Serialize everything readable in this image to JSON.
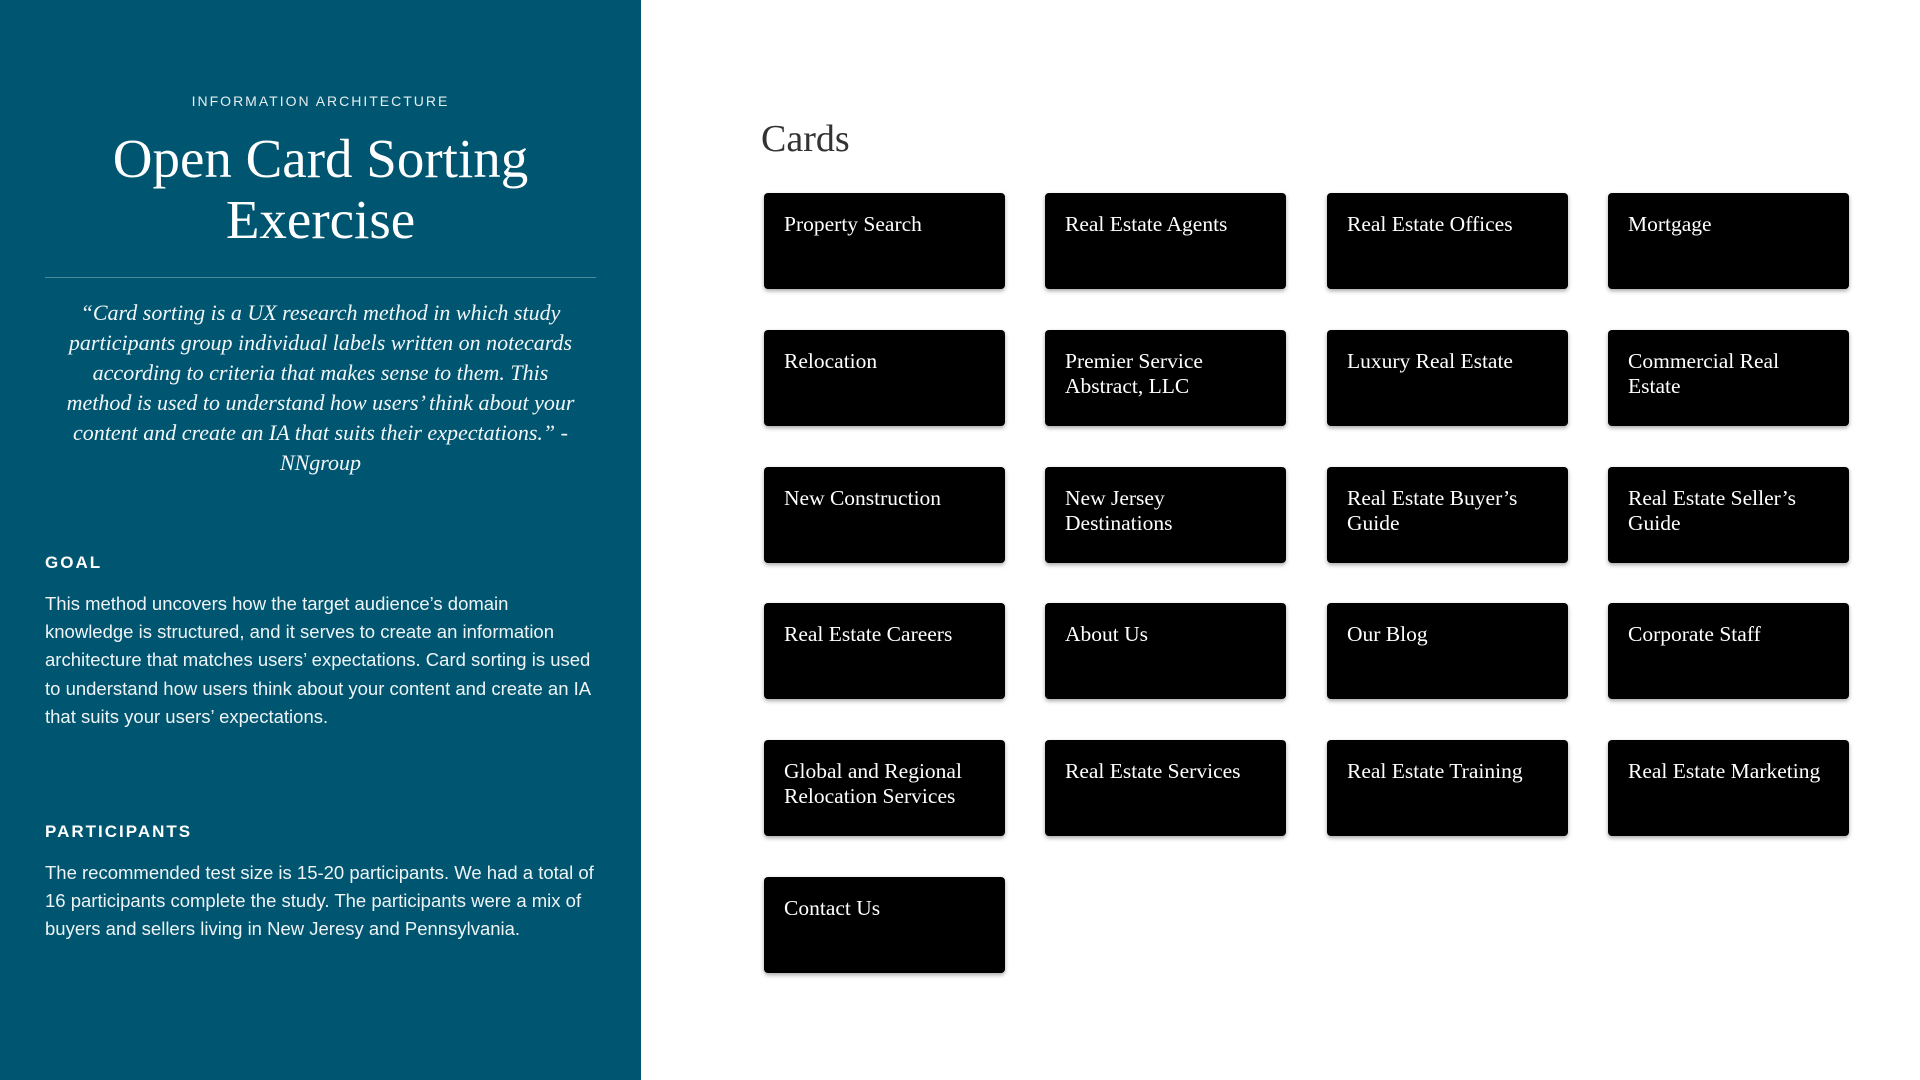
{
  "sidebar": {
    "eyebrow": "INFORMATION ARCHITECTURE",
    "title_line1": "Open Card Sorting",
    "title_line2": "Exercise",
    "quote": "“Card sorting is a UX research method in which study participants group individual labels written on notecards according to criteria that makes sense to them. This method is used to understand how users’ think about your content and create an IA that suits their expectations.” - NNgroup",
    "goal": {
      "heading": "GOAL",
      "body": "This method uncovers how the target audience’s domain knowledge is structured, and it serves to create an information architecture that matches users’ expectations. Card sorting is used to understand how users think about your content and create an IA that suits your users’ expectations."
    },
    "participants": {
      "heading": "PARTICIPANTS",
      "body": "The recommended test size is 15-20 participants. We had a total of 16 participants complete the study. The participants were a mix of buyers and sellers living in New Jeresy and Pennsylvania."
    }
  },
  "cards_section": {
    "title": "Cards",
    "cards": [
      "Property Search",
      "Real Estate Agents",
      "Real Estate Offices",
      "Mortgage",
      "Relocation",
      "Premier Service Abstract, LLC",
      "Luxury Real Estate",
      "Commercial Real Estate",
      "New Construction",
      "New Jersey Destinations",
      "Real Estate Buyer’s Guide",
      "Real Estate Seller’s Guide",
      "Real Estate Careers",
      "About Us",
      "Our Blog",
      "Corporate Staff",
      "Global and Regional Relocation Services",
      "Real Estate Services",
      "Real Estate Training",
      "Real Estate Marketing",
      "Contact Us"
    ]
  },
  "colors": {
    "sidebar_bg": "#005670",
    "card_bg": "#000000",
    "card_text": "#ffffff",
    "page_bg": "#ffffff"
  }
}
